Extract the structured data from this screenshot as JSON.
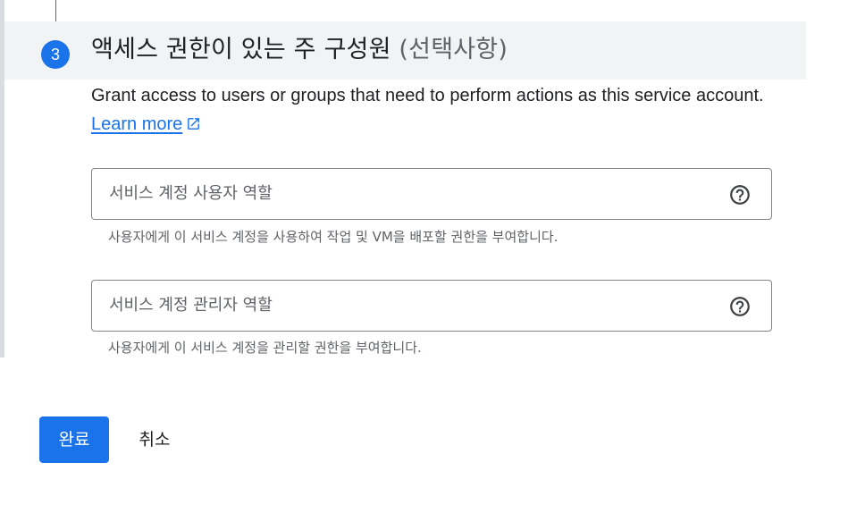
{
  "step": {
    "number": "3",
    "title_main": "액세스 권한이 있는 주 구성원",
    "title_optional": "(선택사항)"
  },
  "description": {
    "text": "Grant access to users or groups that need to perform actions as this service account.",
    "link_label": "Learn more"
  },
  "fields": [
    {
      "placeholder": "서비스 계정 사용자 역할",
      "hint": "사용자에게 이 서비스 계정을 사용하여 작업 및 VM을 배포할 권한을 부여합니다."
    },
    {
      "placeholder": "서비스 계정 관리자 역할",
      "hint": "사용자에게 이 서비스 계정을 관리할 권한을 부여합니다."
    }
  ],
  "actions": {
    "done_label": "완료",
    "cancel_label": "취소"
  },
  "colors": {
    "accent": "#1a73e8",
    "header_bg": "#f1f3f4",
    "text_secondary": "#5f6368"
  },
  "icons": {
    "link": "open-in-new-icon",
    "field_help": "help-circle-icon"
  }
}
